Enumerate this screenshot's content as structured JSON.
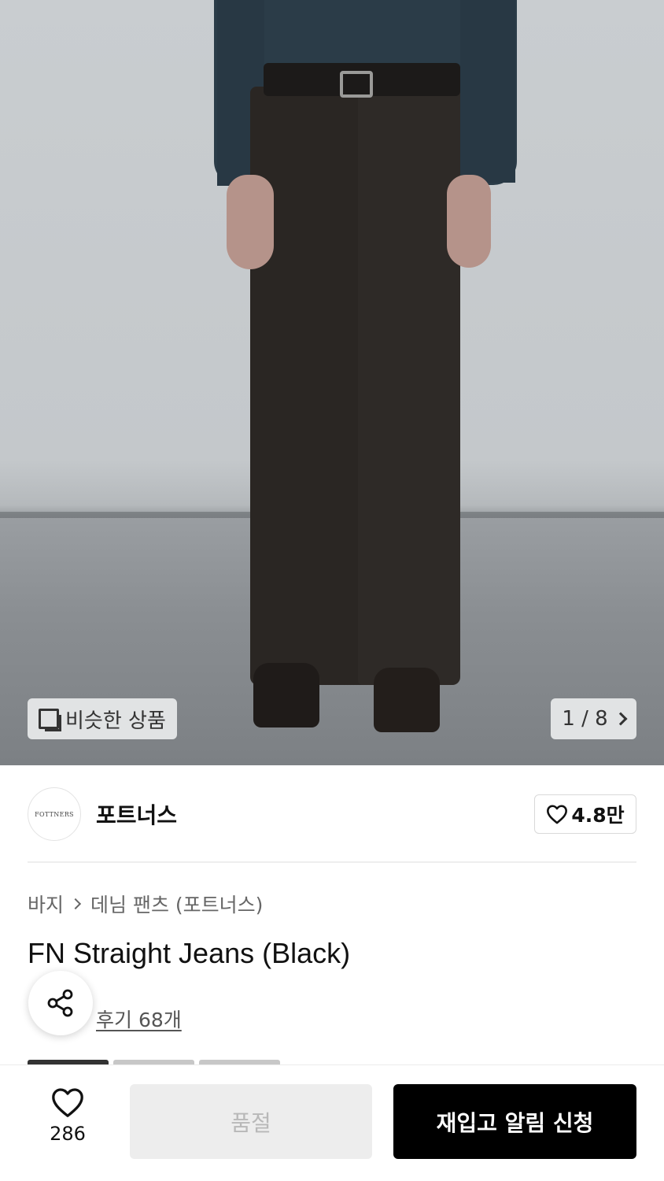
{
  "hero": {
    "similar_label": "비슷한 상품",
    "counter": "1 / 8"
  },
  "brand": {
    "logo_text": "FOTTNERS",
    "name": "포트너스",
    "likes": "4.8만"
  },
  "breadcrumb": {
    "level1": "바지",
    "level2": "데님 팬츠 (포트너스)"
  },
  "product": {
    "title": "FN Straight Jeans (Black)",
    "reviews": "후기 68개"
  },
  "bottom": {
    "wish_count": "286",
    "soldout_label": "품절",
    "restock_label": "재입고 알림 신청"
  },
  "colors": {
    "primary_button": "#000000",
    "disabled_button": "#ededed"
  },
  "icons": [
    "similar-products-icon",
    "chevron-right-icon",
    "heart-icon",
    "share-icon"
  ]
}
